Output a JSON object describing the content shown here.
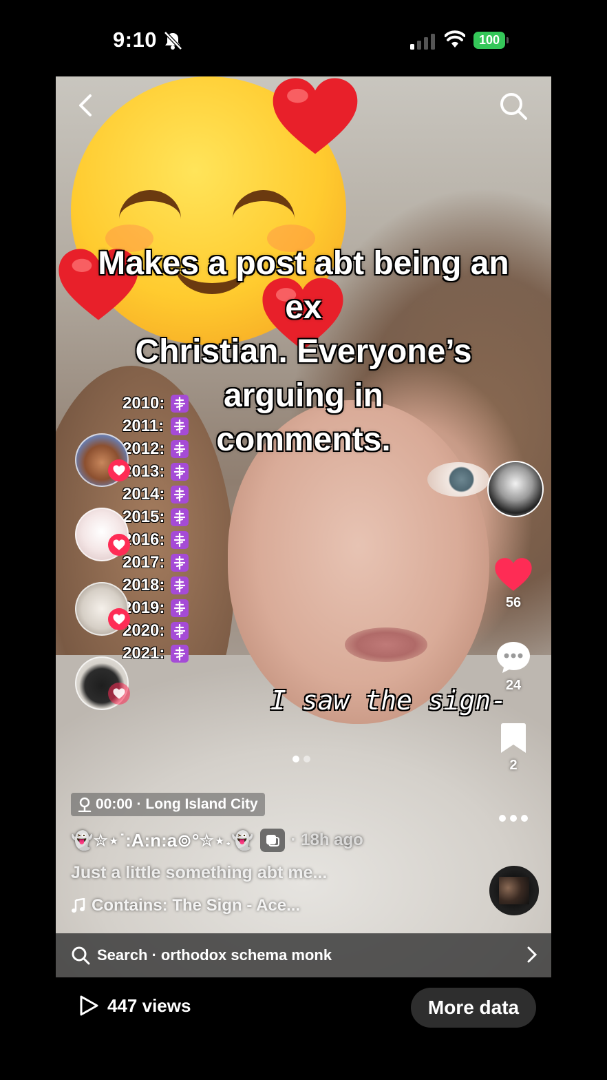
{
  "status_bar": {
    "time": "9:10",
    "battery": "100",
    "battery_color": "#35c759"
  },
  "video": {
    "caption_lines": [
      "Makes a post abt being an",
      "ex",
      "Christian. Everyone’s",
      "arguing in",
      "comments."
    ],
    "years": [
      {
        "year": "2010:"
      },
      {
        "year": "2011:"
      },
      {
        "year": "2012:"
      },
      {
        "year": "2013:"
      },
      {
        "year": "2014:"
      },
      {
        "year": "2015:"
      },
      {
        "year": "2016:"
      },
      {
        "year": "2017:"
      },
      {
        "year": "2018:"
      },
      {
        "year": "2019:"
      },
      {
        "year": "2020:"
      },
      {
        "year": "2021:"
      }
    ],
    "year_badge_color": "#a54bd6",
    "overlay_text": "I saw the sign-",
    "icons": [
      "back-icon",
      "search-icon",
      "heart-icon",
      "comment-icon",
      "bookmark-icon",
      "more-icon",
      "location-pin-icon",
      "music-note-icon",
      "play-icon"
    ]
  },
  "rail": {
    "likes": "56",
    "comments": "24",
    "saves": "2",
    "like_color": "#fe2c55"
  },
  "post": {
    "location": "00:00 · Long Island City",
    "username": "👻✮⋆˙:A:n:a⊚°✮⋆˖👻",
    "time_ago": "· 18h ago",
    "description": "Just a little something abt me...",
    "sound": "Contains: The Sign - Ace..."
  },
  "search": {
    "text": "Search · orthodox schema monk"
  },
  "bottom": {
    "views": "447 views",
    "more_data_label": "More data"
  }
}
